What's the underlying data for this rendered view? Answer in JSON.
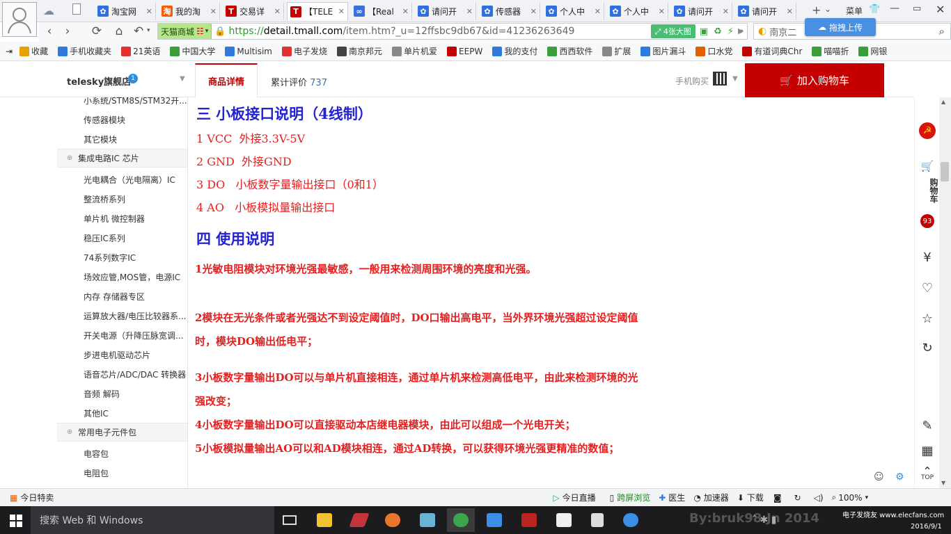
{
  "tabs": [
    {
      "label": "淘宝网",
      "icon": "paw-icon",
      "color": "#2f6fe0"
    },
    {
      "label": "我的淘",
      "icon": "taobao-icon",
      "color": "#ff5a00"
    },
    {
      "label": "交易详",
      "icon": "tmall-t-icon",
      "color": "#c40000"
    },
    {
      "label": "【TELE",
      "icon": "tmall-t-icon",
      "color": "#c40000"
    },
    {
      "label": "【Real",
      "icon": "link-icon",
      "color": "#3a6fe0"
    },
    {
      "label": "请问开",
      "icon": "paw-icon",
      "color": "#2f6fe0"
    },
    {
      "label": "传感器",
      "icon": "paw-icon",
      "color": "#2f6fe0"
    },
    {
      "label": "个人中",
      "icon": "paw-icon",
      "color": "#2f6fe0"
    },
    {
      "label": "个人中",
      "icon": "paw-icon",
      "color": "#2f6fe0"
    },
    {
      "label": "请问开",
      "icon": "paw-icon",
      "color": "#2f6fe0"
    },
    {
      "label": "请问开",
      "icon": "paw-icon",
      "color": "#2f6fe0"
    }
  ],
  "menu_label": "菜单",
  "address": {
    "site_button": "天猫商城",
    "url_prefix": "https://",
    "url_host": "detail.tmall.com",
    "url_path": "/item.htm?_u=12ffsbc9db67&id=41236263649",
    "big_image_btn": "4张大图",
    "search_text": "南京二",
    "upload_btn": "拖拽上传"
  },
  "bookmarks": [
    "收藏",
    "手机收藏夹",
    "21英语",
    "中国大学",
    "Multisim",
    "电子发烧",
    "南京邦元",
    "单片机爱",
    "EEPW",
    "我的支付",
    "西西软件",
    "扩展",
    "图片漏斗",
    "口水党",
    "有道词典Chr",
    "喵喵折",
    "网银"
  ],
  "store": {
    "name": "telesky旗舰店",
    "badge": "1",
    "tab_detail": "商品详情",
    "tab_reviews_label": "累计评价",
    "tab_reviews_count": "737",
    "mobile_buy": "手机购买",
    "cart_button": "加入购物车"
  },
  "categories": {
    "items_a": [
      "小系统/STM8S/STM32开...",
      "传感器模块",
      "其它模块"
    ],
    "head_ic": "集成电路IC 芯片",
    "items_b": [
      "光电耦合（光电隔离）IC",
      "整流桥系列",
      "单片机 微控制器",
      "稳压IC系列",
      "74系列数字IC",
      "场效应管,MOS管，电源IC",
      "内存 存储器专区",
      "运算放大器/电压比较器系...",
      "开关电源（升降压脉宽调...",
      "步进电机驱动芯片",
      "语音芯片/ADC/DAC 转换器",
      "音频 解码",
      "其他IC"
    ],
    "head_pkg": "常用电子元件包",
    "items_c": [
      "电容包",
      "电阻包"
    ]
  },
  "content": {
    "section3": "三 小板接口说明（4线制）",
    "interface": [
      "1 VCC  外接3.3V-5V",
      "2 GND  外接GND",
      "3 DO   小板数字量输出接口（0和1）",
      "4 AO   小板模拟量输出接口"
    ],
    "section4": "四 使用说明",
    "p1": "1光敏电阻模块对环境光强最敏感，一般用来检测周围环境的亮度和光强。",
    "p2a": "2模块在无光条件或者光强达不到设定阈值时，DO口输出高电平，当外界环境光强超过设定阈值",
    "p2b": "时，模块DO输出低电平；",
    "p3a": "3小板数字量输出DO可以与单片机直接相连，通过单片机来检测高低电平，由此来检测环境的光",
    "p3b": "强改变；",
    "p4": "4小板数字量输出DO可以直接驱动本店继电器模块，由此可以组成一个光电开关；",
    "p5": "5小板模拟量输出AO可以和AD模块相连，通过AD转换，可以获得环境光强更精准的数值；"
  },
  "sidebar": {
    "cart_label": "购物车",
    "cart_count": "93",
    "top_label": "TOP"
  },
  "status": {
    "today_deals": "今日特卖",
    "live": "今日直播",
    "screen_browse": "跨屏浏览",
    "doctor": "医生",
    "accelerator": "加速器",
    "download": "下载",
    "zoom": "100%"
  },
  "taskbar": {
    "search": "搜索 Web 和 Windows",
    "watermark": "By:bruk98.Jn 2014",
    "date": "2016/9/1",
    "site_mark": "电子发烧友 www.elecfans.com"
  },
  "colors": {
    "brand_red": "#c40000",
    "heading_blue": "#2323d2",
    "text_red": "#e52020"
  }
}
